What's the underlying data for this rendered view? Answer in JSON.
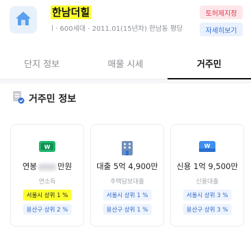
{
  "header": {
    "title": "한남더힐",
    "subtitle": "ㅣ· 600세대 · 2011.01(15년차)  한남동 평당",
    "badge_red": "토허제지정",
    "badge_blue": "자세히보기"
  },
  "tabs": [
    {
      "label": "단지 정보"
    },
    {
      "label": "매물 시세"
    },
    {
      "label": "거주민"
    }
  ],
  "section": {
    "title": "거주민 정보",
    "icon": "document-check-icon"
  },
  "cards": [
    {
      "icon": "cash-icon",
      "main_prefix": "연봉",
      "main_suffix": "만원",
      "caption": "연소득",
      "pills": [
        "서울시 상위 1 %",
        "용산구 상위 2 %"
      ]
    },
    {
      "icon": "building-icon",
      "main": "대출 5억 4,900만",
      "caption": "주택담보대출",
      "pills": [
        "서울시 상위 1 %",
        "용산구 상위 1 %"
      ]
    },
    {
      "icon": "card-icon",
      "main": "신용 1억 9,500만",
      "caption": "신용대출",
      "pills": [
        "서울시 상위 3 %",
        "용산구 상위 3 %"
      ]
    }
  ],
  "colors": {
    "highlight": "#fcff2b",
    "accent_blue": "#2f6fdc",
    "accent_red": "#e5364b",
    "cash_green": "#1fb56b"
  }
}
